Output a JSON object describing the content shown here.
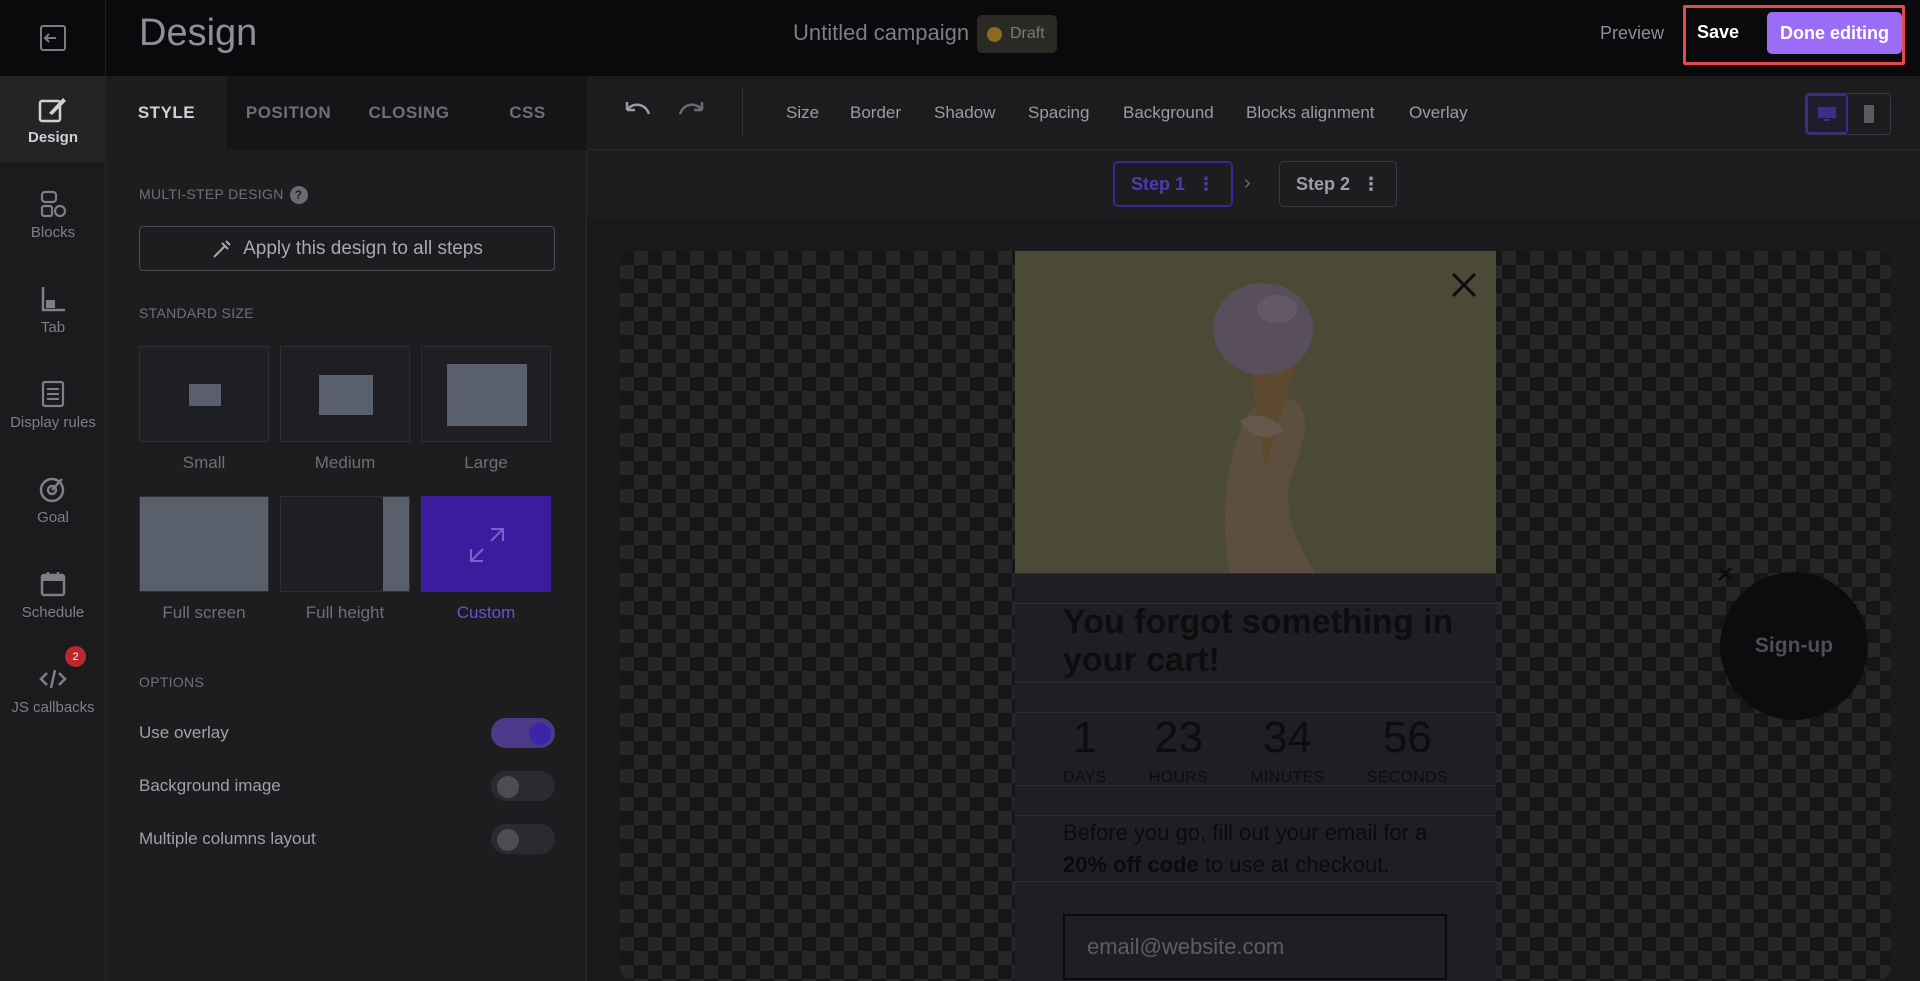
{
  "topbar": {
    "title": "Design",
    "campaign_name": "Untitled campaign",
    "status": "Draft",
    "preview_label": "Preview",
    "save_label": "Save",
    "done_label": "Done editing"
  },
  "rail": {
    "items": [
      {
        "label": "Design",
        "icon": "brush-icon"
      },
      {
        "label": "Blocks",
        "icon": "blocks-icon"
      },
      {
        "label": "Tab",
        "icon": "tab-icon"
      },
      {
        "label": "Display rules",
        "icon": "list-icon"
      },
      {
        "label": "Goal",
        "icon": "target-icon"
      },
      {
        "label": "Schedule",
        "icon": "calendar-icon"
      },
      {
        "label": "JS callbacks",
        "icon": "code-icon",
        "badge": "2"
      }
    ]
  },
  "panel": {
    "tabs": [
      "STYLE",
      "POSITION",
      "CLOSING",
      "CSS"
    ],
    "multistep_title": "MULTI-STEP DESIGN",
    "help_glyph": "?",
    "apply_label": "Apply this design to all steps",
    "standard_size_title": "STANDARD SIZE",
    "sizes": [
      "Small",
      "Medium",
      "Large",
      "Full screen",
      "Full height",
      "Custom"
    ],
    "selected_size": "Custom",
    "options_title": "OPTIONS",
    "options": [
      {
        "label": "Use overlay",
        "on": true
      },
      {
        "label": "Background image",
        "on": false
      },
      {
        "label": "Multiple columns layout",
        "on": false
      }
    ]
  },
  "toolbar": {
    "links": [
      "Size",
      "Border",
      "Shadow",
      "Spacing",
      "Background",
      "Blocks alignment",
      "Overlay"
    ],
    "device_selected": "desktop"
  },
  "steps": {
    "items": [
      "Step 1",
      "Step 2"
    ],
    "active": "Step 1",
    "menu_glyph": "⋮",
    "arrow_glyph": "›"
  },
  "popup": {
    "headline": "You forgot something in your cart!",
    "countdown": [
      {
        "value": "1",
        "label": "DAYS"
      },
      {
        "value": "23",
        "label": "HOURS"
      },
      {
        "value": "34",
        "label": "MINUTES"
      },
      {
        "value": "56",
        "label": "SECONDS"
      }
    ],
    "body_before": "Before you go, fill out your email for a ",
    "body_bold": "20% off code",
    "body_after": " to use at checkout.",
    "email_placeholder": "email@website.com",
    "signup_label": "Sign-up"
  },
  "colors": {
    "accent": "#9b6df6",
    "selected_tile": "#3b1c9e",
    "highlight": "#e5484d"
  }
}
